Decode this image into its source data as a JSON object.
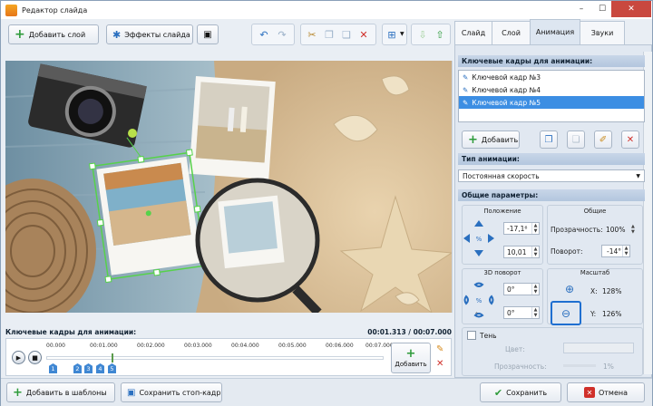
{
  "window": {
    "title": "Редактор слайда",
    "minimize_label": "–",
    "maximize_label": "☐",
    "close_label": "✕"
  },
  "toolbar": {
    "add_layer": "Добавить слой",
    "slide_effects": "Эффекты слайда"
  },
  "tabs": [
    {
      "label": "Слайд"
    },
    {
      "label": "Слой"
    },
    {
      "label": "Анимация"
    },
    {
      "label": "Звуки"
    }
  ],
  "keyframes_panel": {
    "title": "Ключевые кадры для анимации:",
    "items": [
      {
        "label": "Ключевой кадр №3"
      },
      {
        "label": "Ключевой кадр №4"
      },
      {
        "label": "Ключевой кадр №5"
      }
    ],
    "add_label": "Добавить"
  },
  "animation_type": {
    "title": "Тип анимации:",
    "value": "Постоянная скорость"
  },
  "params": {
    "title": "Общие параметры:",
    "position_label": "Положение",
    "position_x": "-17,1⁶",
    "position_y": "10,01",
    "common_label": "Общие",
    "opacity_label": "Прозрачность:",
    "opacity_value": "100%",
    "rotation_label": "Поворот:",
    "rotation_value": "-14°",
    "rot3d_label": "3D поворот",
    "rot3d_a": "0°",
    "rot3d_b": "0°",
    "scale_label": "Масштаб",
    "scale_x_label": "X:",
    "scale_x": "128%",
    "scale_y_label": "Y:",
    "scale_y": "126%"
  },
  "shadow": {
    "label": "Тень",
    "color_label": "Цвет:",
    "opacity_label": "Прозрачность:",
    "opacity_value": "1%"
  },
  "timeline": {
    "title": "Ключевые кадры для анимации:",
    "time": "00:01.313 / 00:07.000",
    "ticks": [
      "00.000",
      "00:01.000",
      "00:02.000",
      "00:03.000",
      "00:04.000",
      "00:05.000",
      "00:06.000",
      "00:07.000"
    ],
    "keyframes": [
      "1",
      "2",
      "3",
      "4",
      "5"
    ],
    "add_label": "Добавить"
  },
  "bottom": {
    "save_template": "Добавить в шаблоны",
    "save_still": "Сохранить стоп-кадр",
    "save": "Сохранить",
    "cancel": "Отмена"
  },
  "colors": {
    "accent": "#3c8ee3",
    "selection_green": "#56d24a",
    "close_red": "#c9483f",
    "save_green": "#2e9b3b"
  }
}
